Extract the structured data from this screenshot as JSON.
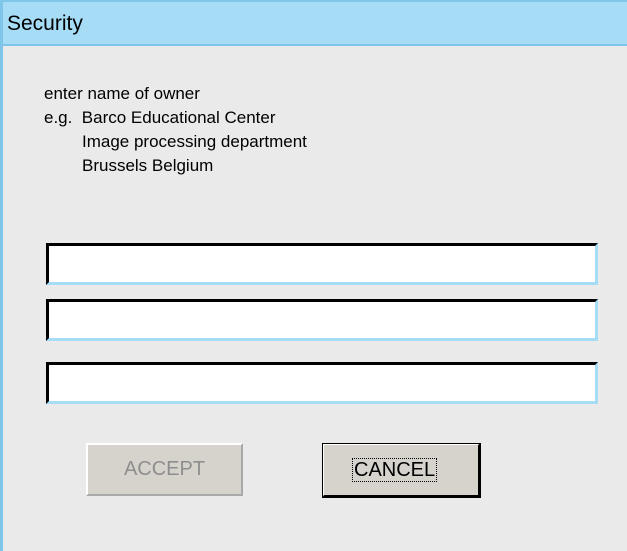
{
  "window": {
    "title": "Security"
  },
  "instructions": {
    "line1": "enter name of owner",
    "line2": "e.g.  Barco Educational Center",
    "line3": "Image processing department",
    "line4": "Brussels Belgium"
  },
  "fields": [
    {
      "value": "",
      "placeholder": ""
    },
    {
      "value": "",
      "placeholder": ""
    },
    {
      "value": "",
      "placeholder": ""
    }
  ],
  "buttons": {
    "accept_label": "ACCEPT",
    "accept_state": "disabled",
    "cancel_label": "CANCEL",
    "cancel_state": "focused"
  },
  "colors": {
    "titlebar": "#a6dcf5",
    "window_border": "#7fc6ea",
    "dialog_background": "#eaeaea",
    "button_face": "#d6d3cc",
    "disabled_text": "#8e8e8e"
  }
}
